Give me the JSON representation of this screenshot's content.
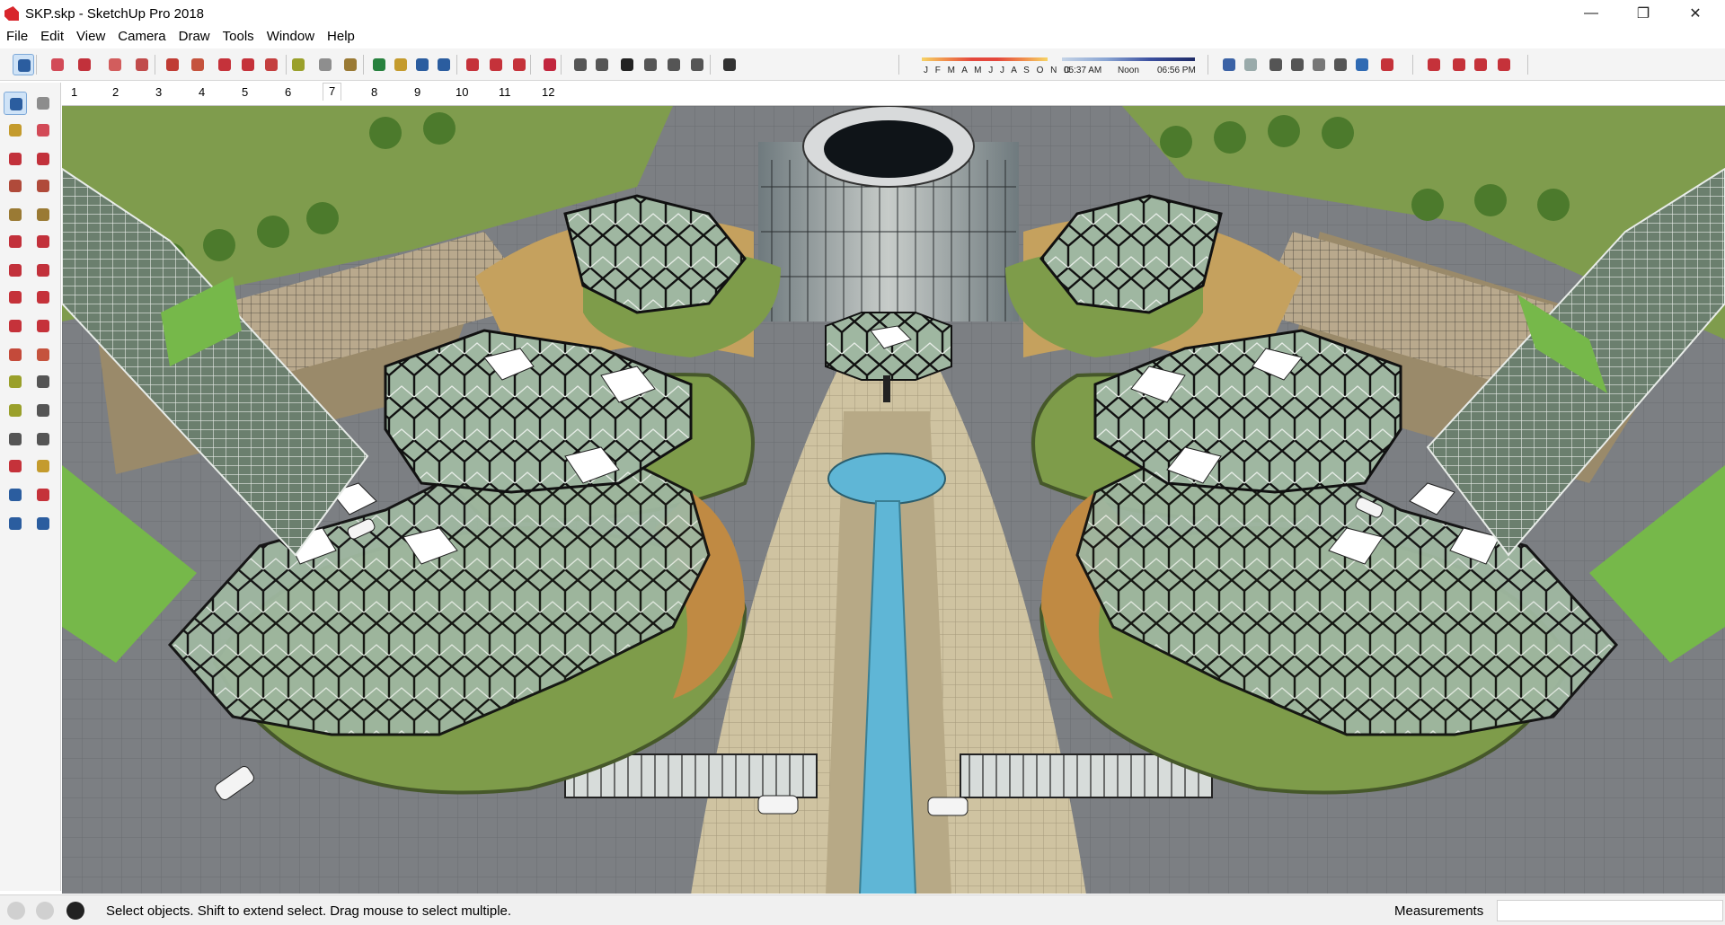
{
  "window": {
    "title": "SKP.skp - SketchUp Pro 2018",
    "controls": {
      "minimize": "—",
      "restore": "❐",
      "close": "✕"
    }
  },
  "menu": [
    "File",
    "Edit",
    "View",
    "Camera",
    "Draw",
    "Tools",
    "Window",
    "Help"
  ],
  "shadow_settings": {
    "months": "J F M A M J J A S O N D",
    "time_start": "05:37 AM",
    "time_mid": "Noon",
    "time_end": "06:56 PM"
  },
  "scenes": [
    "1",
    "2",
    "3",
    "4",
    "5",
    "6",
    "7",
    "8",
    "9",
    "10",
    "11",
    "12"
  ],
  "active_scene": "7",
  "status": {
    "hint": "Select objects. Shift to extend select. Drag mouse to select multiple.",
    "measurements_label": "Measurements",
    "measurements_value": ""
  },
  "colors": {
    "accent_select": "#cfe3f7",
    "grass": "#7e9c4a",
    "glass": "#a9bfa9",
    "water": "#5fb6d6",
    "pavement": "#7a7d80"
  },
  "toolbar_icons": [
    "select-icon",
    "eraser-icon",
    "pencil-icon",
    "lasso-icon",
    "paint-icon",
    "push-pull-icon",
    "follow-me-icon",
    "move-icon",
    "rotate-icon",
    "scale-icon",
    "tape-measure-icon",
    "text-icon",
    "paint-bucket-icon",
    "orbit-icon",
    "pan-icon",
    "zoom-icon",
    "zoom-extents-icon",
    "3d-warehouse-icon",
    "extension-warehouse-icon",
    "layout-icon",
    "ruby-icon",
    "iso-view-icon",
    "top-view-icon",
    "front-view-icon",
    "right-view-icon",
    "back-view-icon",
    "left-view-icon",
    "shadow-toggle-icon",
    "style-xray-icon",
    "style-backedges-icon",
    "style-wireframe-icon",
    "style-hiddenline-icon",
    "style-shaded-icon",
    "style-textured-icon",
    "style-monochrome-icon",
    "section-plane-icon",
    "section-display-icon",
    "section-cut-icon",
    "section-fill-icon",
    "component-icon",
    "group-icon",
    "solid-tools-icon",
    "sandbox-icon"
  ],
  "left_tools": [
    "select-icon",
    "component-icon",
    "paint-bucket-icon",
    "eraser-icon",
    "line-icon",
    "freehand-icon",
    "rectangle-icon",
    "rotated-rect-icon",
    "circle-icon",
    "polygon-icon",
    "arc-icon",
    "pie-icon",
    "two-point-arc-icon",
    "three-point-arc-icon",
    "move-icon",
    "push-pull-icon",
    "rotate-icon",
    "follow-me-icon",
    "scale-icon",
    "offset-icon",
    "tape-measure-icon",
    "dimension-icon",
    "protractor-icon",
    "text-icon",
    "axes-icon",
    "3d-text-icon",
    "orbit-icon",
    "pan-icon",
    "zoom-icon",
    "zoom-window-icon",
    "zoom-extents-icon",
    "previous-view-icon",
    "position-camera-icon",
    "look-around-icon",
    "walk-icon",
    "section-plane-icon"
  ]
}
